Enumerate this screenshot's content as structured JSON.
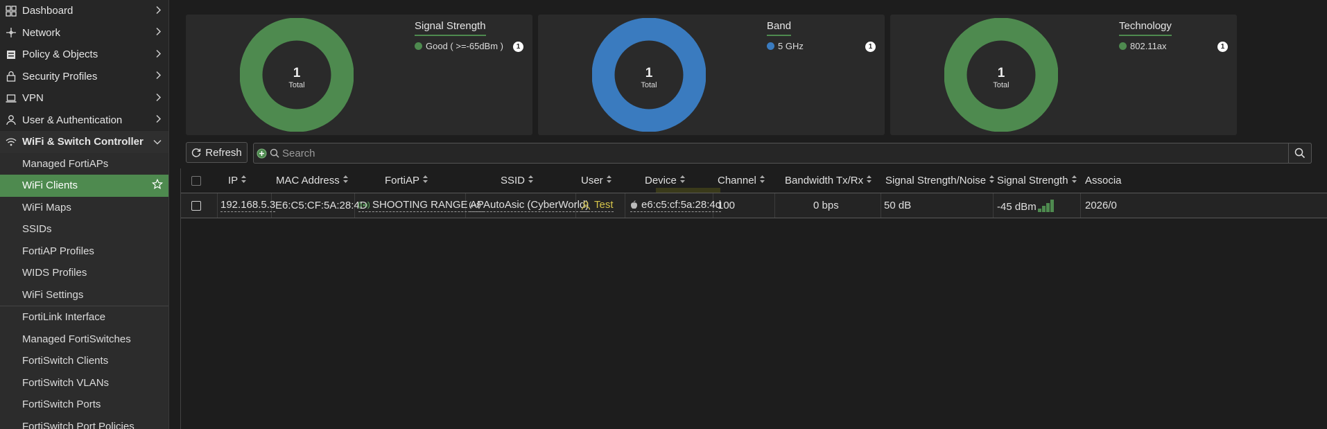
{
  "sidebar": {
    "items": [
      {
        "label": "Dashboard",
        "icon": "dashboard-icon"
      },
      {
        "label": "Network",
        "icon": "network-icon"
      },
      {
        "label": "Policy & Objects",
        "icon": "policy-icon"
      },
      {
        "label": "Security Profiles",
        "icon": "lock-icon"
      },
      {
        "label": "VPN",
        "icon": "laptop-icon"
      },
      {
        "label": "User & Authentication",
        "icon": "user-icon"
      }
    ],
    "section": {
      "label": "WiFi & Switch Controller",
      "icon": "wifi-icon"
    },
    "wifi_sub": [
      "Managed FortiAPs",
      "WiFi Clients",
      "WiFi Maps",
      "SSIDs",
      "FortiAP Profiles",
      "WIDS Profiles",
      "WiFi Settings"
    ],
    "switch_sub": [
      "FortiLink Interface",
      "Managed FortiSwitches",
      "FortiSwitch Clients",
      "FortiSwitch VLANs",
      "FortiSwitch Ports",
      "FortiSwitch Port Policies"
    ],
    "active": "WiFi Clients"
  },
  "widgets": [
    {
      "title": "Signal Strength",
      "legend": "Good ( >=-65dBm )",
      "count": "1",
      "total_value": "1",
      "total_label": "Total",
      "color": "#4e8a4f"
    },
    {
      "title": "Band",
      "legend": "5 GHz",
      "count": "1",
      "total_value": "1",
      "total_label": "Total",
      "color": "#3a7bbf"
    },
    {
      "title": "Technology",
      "legend": "802.11ax",
      "count": "1",
      "total_value": "1",
      "total_label": "Total",
      "color": "#4e8a4f"
    }
  ],
  "toolbar": {
    "refresh_label": "Refresh",
    "search_placeholder": "Search"
  },
  "table": {
    "headers": [
      "IP",
      "MAC Address",
      "FortiAP",
      "SSID",
      "User",
      "Device",
      "Channel",
      "Bandwidth Tx/Rx",
      "Signal Strength/Noise",
      "Signal Strength",
      "Associa"
    ],
    "row": {
      "ip": "192.168.5.3",
      "mac": "E6:C5:CF:5A:28:4D",
      "fortiap": "SHOOTING RANGE AP",
      "ssid": "AutoAsic (CyberWorld)",
      "user": "Test",
      "device": "e6:c5:cf:5a:28:4d",
      "channel": "100",
      "bandwidth": "0 bps",
      "snr": "50 dB",
      "signal": "-45 dBm",
      "associated": "2026/0"
    }
  },
  "colors": {
    "accent": "#4e8a4f",
    "band": "#3a7bbf",
    "user_text": "#d6c54a"
  }
}
